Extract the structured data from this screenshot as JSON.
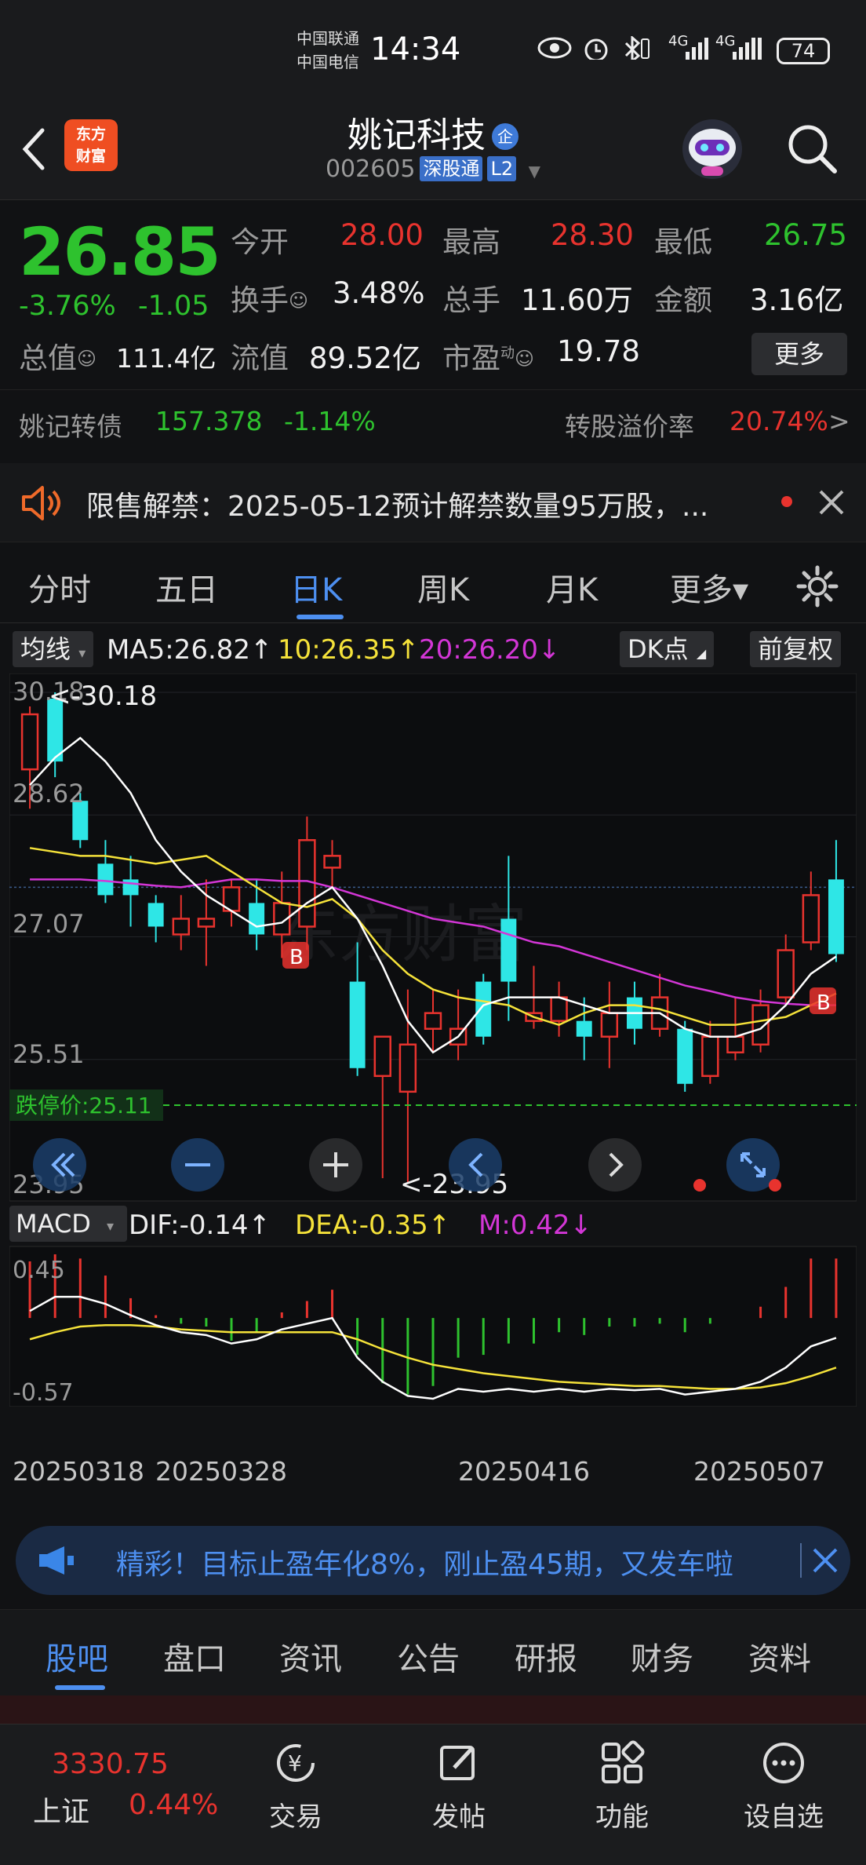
{
  "status": {
    "carrier1": "中国联通",
    "carrier2": "中国电信",
    "time": "14:34",
    "net1": "4G",
    "net2": "4G",
    "battery": "74"
  },
  "header": {
    "logo_line1": "东方",
    "logo_line2": "财富",
    "stock_name": "姚记科技",
    "badge": "企",
    "code": "002605",
    "tag1": "深股通",
    "tag2": "L2"
  },
  "quote": {
    "price": "26.85",
    "change_pct": "-3.76%",
    "change": "-1.05",
    "open_label": "今开",
    "open": "28.00",
    "high_label": "最高",
    "high": "28.30",
    "low_label": "最低",
    "low": "26.75",
    "turnover_label": "换手",
    "turnover": "3.48%",
    "volume_label": "总手",
    "volume": "11.60万",
    "amount_label": "金额",
    "amount": "3.16亿",
    "mktcap_label": "总值",
    "mktcap": "111.4亿",
    "float_label": "流值",
    "float": "89.52亿",
    "pe_label": "市盈",
    "pe_sup": "动",
    "pe": "19.78",
    "more": "更多"
  },
  "bond": {
    "name": "姚记转债",
    "price": "157.378",
    "change": "-1.14%",
    "premium_label": "转股溢价率",
    "premium": "20.74%",
    "arrow": ">"
  },
  "notice": {
    "text": "限售解禁：2025-05-12预计解禁数量95万股，..."
  },
  "ktabs": [
    "分时",
    "五日",
    "日K",
    "周K",
    "月K",
    "更多▾"
  ],
  "ma": {
    "chip": "均线",
    "ma5": "MA5:26.82↑",
    "ma10": "10:26.35↑",
    "ma20": "20:26.20↓",
    "dk": "DK点",
    "adjust": "前复权"
  },
  "macd": {
    "chip": "MACD",
    "dif": "DIF:-0.14↑",
    "dea": "DEA:-0.35↑",
    "m": "M:0.42↓",
    "top": "0.45",
    "bottom": "-0.57"
  },
  "chart_labels": {
    "y1": "30.18",
    "y2": "28.62",
    "y3": "27.07",
    "y4": "25.51",
    "y5": "23.95",
    "high_mark": "<-30.18",
    "low_mark": "<-23.95",
    "limit_down": "跌停价:25.11",
    "buy_marker": "B",
    "dates": [
      "20250318",
      "20250328",
      "20250416",
      "20250507"
    ]
  },
  "chart_data": {
    "type": "candlestick",
    "ylim": [
      23.95,
      30.18
    ],
    "candles": [
      {
        "o": 29.2,
        "c": 29.9,
        "h": 30.0,
        "l": 28.7
      },
      {
        "o": 30.1,
        "c": 29.3,
        "h": 30.18,
        "l": 29.1
      },
      {
        "o": 28.8,
        "c": 28.3,
        "h": 28.9,
        "l": 28.2
      },
      {
        "o": 28.0,
        "c": 27.6,
        "h": 28.3,
        "l": 27.5
      },
      {
        "o": 27.8,
        "c": 27.6,
        "h": 28.1,
        "l": 27.2
      },
      {
        "o": 27.5,
        "c": 27.2,
        "h": 27.6,
        "l": 27.0
      },
      {
        "o": 27.1,
        "c": 27.3,
        "h": 27.6,
        "l": 26.9
      },
      {
        "o": 27.2,
        "c": 27.3,
        "h": 27.8,
        "l": 26.7
      },
      {
        "o": 27.4,
        "c": 27.7,
        "h": 27.8,
        "l": 27.2
      },
      {
        "o": 27.5,
        "c": 27.1,
        "h": 27.8,
        "l": 26.9
      },
      {
        "o": 27.1,
        "c": 27.5,
        "h": 27.9,
        "l": 26.8
      },
      {
        "o": 27.2,
        "c": 28.3,
        "h": 28.6,
        "l": 26.9
      },
      {
        "o": 27.95,
        "c": 28.1,
        "h": 28.3,
        "l": 27.7
      },
      {
        "o": 26.5,
        "c": 25.4,
        "h": 27.0,
        "l": 25.3
      },
      {
        "o": 25.3,
        "c": 25.8,
        "h": 25.8,
        "l": 24.0
      },
      {
        "o": 25.1,
        "c": 25.7,
        "h": 26.4,
        "l": 23.95
      },
      {
        "o": 25.9,
        "c": 26.1,
        "h": 26.4,
        "l": 25.6
      },
      {
        "o": 25.7,
        "c": 25.9,
        "h": 26.4,
        "l": 25.5
      },
      {
        "o": 26.5,
        "c": 25.8,
        "h": 26.6,
        "l": 25.7
      },
      {
        "o": 27.3,
        "c": 26.5,
        "h": 28.1,
        "l": 26.0
      },
      {
        "o": 26.0,
        "c": 26.1,
        "h": 26.7,
        "l": 25.9
      },
      {
        "o": 26.0,
        "c": 26.3,
        "h": 26.5,
        "l": 25.8
      },
      {
        "o": 26.0,
        "c": 25.8,
        "h": 26.3,
        "l": 25.5
      },
      {
        "o": 25.8,
        "c": 26.1,
        "h": 26.5,
        "l": 25.4
      },
      {
        "o": 26.3,
        "c": 25.9,
        "h": 26.5,
        "l": 25.7
      },
      {
        "o": 25.9,
        "c": 26.3,
        "h": 26.6,
        "l": 25.8
      },
      {
        "o": 25.9,
        "c": 25.2,
        "h": 26.0,
        "l": 25.1
      },
      {
        "o": 25.3,
        "c": 25.8,
        "h": 26.0,
        "l": 25.2
      },
      {
        "o": 25.6,
        "c": 25.8,
        "h": 26.3,
        "l": 25.5
      },
      {
        "o": 25.7,
        "c": 26.2,
        "h": 26.4,
        "l": 25.6
      },
      {
        "o": 26.3,
        "c": 26.9,
        "h": 27.1,
        "l": 26.2
      },
      {
        "o": 27.0,
        "c": 27.6,
        "h": 27.9,
        "l": 26.9
      },
      {
        "o": 27.8,
        "c": 26.85,
        "h": 28.3,
        "l": 26.75
      }
    ],
    "ma5": [
      29.0,
      29.35,
      29.6,
      29.3,
      28.9,
      28.3,
      27.9,
      27.6,
      27.4,
      27.2,
      27.25,
      27.5,
      27.7,
      27.3,
      26.7,
      26.0,
      25.6,
      25.8,
      26.2,
      26.3,
      26.3,
      26.3,
      26.2,
      26.1,
      26.1,
      26.1,
      25.9,
      25.8,
      25.8,
      25.9,
      26.2,
      26.6,
      26.82
    ],
    "ma10": [
      28.2,
      28.15,
      28.1,
      28.1,
      28.05,
      28.0,
      28.05,
      28.1,
      27.9,
      27.7,
      27.5,
      27.45,
      27.55,
      27.3,
      26.9,
      26.6,
      26.4,
      26.3,
      26.25,
      26.2,
      26.05,
      25.95,
      26.1,
      26.2,
      26.2,
      26.15,
      26.05,
      25.95,
      25.95,
      26.0,
      26.05,
      26.2,
      26.35
    ],
    "ma20": [
      27.8,
      27.8,
      27.8,
      27.78,
      27.75,
      27.72,
      27.7,
      27.75,
      27.8,
      27.8,
      27.78,
      27.78,
      27.7,
      27.6,
      27.5,
      27.4,
      27.3,
      27.25,
      27.2,
      27.1,
      27.0,
      26.95,
      26.85,
      26.75,
      26.65,
      26.55,
      26.45,
      26.38,
      26.3,
      26.25,
      26.22,
      26.2,
      26.2
    ],
    "macd_ylim": [
      -0.57,
      0.45
    ],
    "dif": [
      0.05,
      0.15,
      0.15,
      0.1,
      0.02,
      -0.05,
      -0.1,
      -0.12,
      -0.18,
      -0.15,
      -0.08,
      -0.04,
      0.0,
      -0.28,
      -0.45,
      -0.55,
      -0.57,
      -0.5,
      -0.52,
      -0.5,
      -0.52,
      -0.5,
      -0.52,
      -0.5,
      -0.51,
      -0.5,
      -0.54,
      -0.52,
      -0.5,
      -0.45,
      -0.35,
      -0.2,
      -0.14
    ],
    "dea": [
      -0.15,
      -0.1,
      -0.06,
      -0.05,
      -0.05,
      -0.06,
      -0.08,
      -0.09,
      -0.1,
      -0.1,
      -0.1,
      -0.1,
      -0.1,
      -0.15,
      -0.22,
      -0.28,
      -0.33,
      -0.36,
      -0.39,
      -0.41,
      -0.43,
      -0.45,
      -0.46,
      -0.47,
      -0.48,
      -0.48,
      -0.49,
      -0.5,
      -0.5,
      -0.49,
      -0.46,
      -0.41,
      -0.35
    ],
    "m": [
      0.4,
      0.45,
      0.42,
      0.3,
      0.14,
      0.02,
      -0.04,
      -0.06,
      -0.16,
      -0.1,
      0.04,
      0.12,
      0.2,
      -0.26,
      -0.46,
      -0.54,
      -0.48,
      -0.28,
      -0.26,
      -0.18,
      -0.18,
      -0.1,
      -0.12,
      -0.06,
      -0.06,
      -0.04,
      -0.1,
      -0.04,
      0.0,
      0.08,
      0.22,
      0.42,
      0.42
    ]
  },
  "ad": {
    "text": "精彩！目标止盈年化8%，刚止盈45期，又发车啦"
  },
  "bottom_tabs": [
    "股吧",
    "盘口",
    "资讯",
    "公告",
    "研报",
    "财务",
    "资料"
  ],
  "index": {
    "value": "3330.75",
    "name": "上证",
    "change": "0.44%"
  },
  "nav": [
    "交易",
    "发帖",
    "功能",
    "设自选"
  ],
  "colors": {
    "up": "#e8332e",
    "down": "#2ec22e",
    "down_candle": "#2ee6e6",
    "ma5": "#ffffff",
    "ma10": "#f5e23a",
    "ma20": "#d336d6",
    "accent": "#4d8ff0"
  }
}
